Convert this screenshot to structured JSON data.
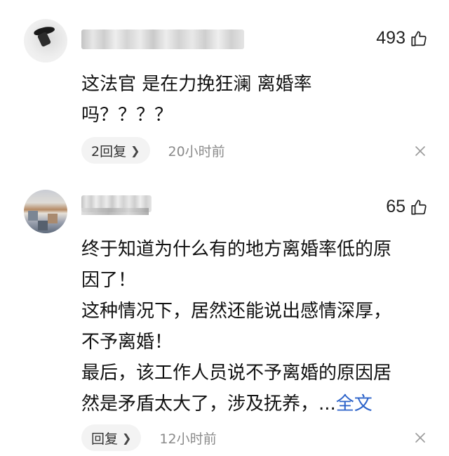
{
  "comments": [
    {
      "likes": "493",
      "lines": [
        "这法官 是在力挽狂澜 离婚率",
        "吗？？？？"
      ],
      "reply_label": "2回复",
      "time": "20小时前"
    },
    {
      "likes": "65",
      "lines": [
        "终于知道为什么有的地方离婚率低的原",
        "因了！",
        "这种情况下，居然还能说出感情深厚，",
        "不予离婚！",
        "最后，该工作人员说不予离婚的原因居"
      ],
      "last_line_text": "然是矛盾太大了，涉及抚养，...",
      "more_link": "全文",
      "reply_label": "回复",
      "time": "12小时前"
    }
  ],
  "icons": {
    "like": "thumbs-up-icon",
    "reply_chevron": "chevron-right-icon",
    "dismiss": "close-icon"
  },
  "colors": {
    "link": "#2b62c9",
    "meta_text": "#8a8a8a",
    "reply_bg": "#f3f3f3"
  }
}
